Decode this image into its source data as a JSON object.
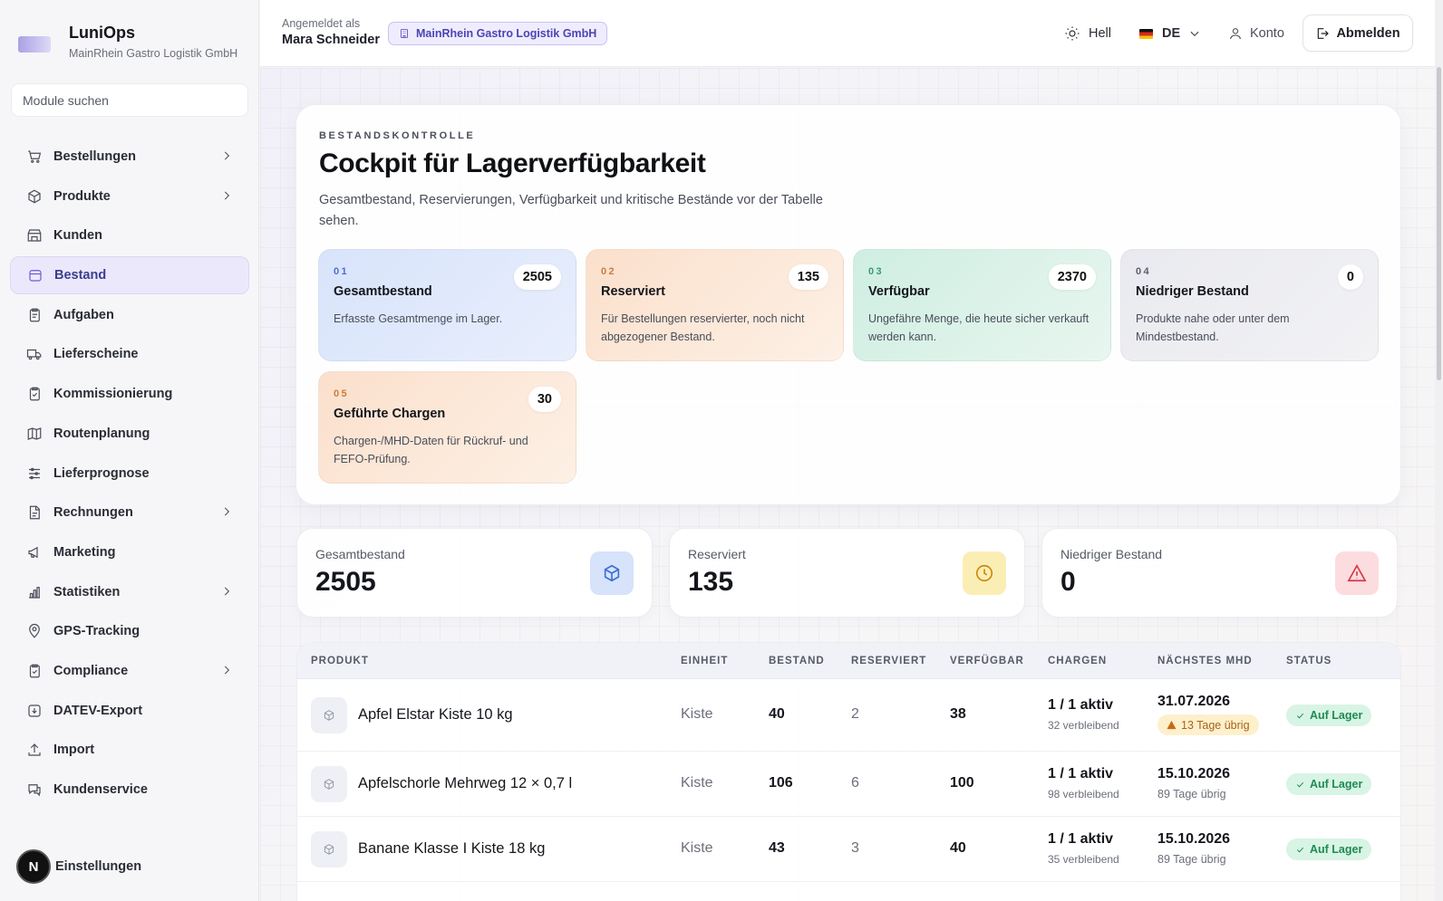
{
  "brand": {
    "name": "LuniOps",
    "company": "MainRhein Gastro Logistik GmbH"
  },
  "search": {
    "placeholder": "Module suchen"
  },
  "sidebar": {
    "items": [
      {
        "label": "Bestellungen",
        "icon": "cart-icon",
        "chevron": true
      },
      {
        "label": "Produkte",
        "icon": "box-icon",
        "chevron": true
      },
      {
        "label": "Kunden",
        "icon": "store-icon",
        "chevron": false
      },
      {
        "label": "Bestand",
        "icon": "inventory-icon",
        "chevron": false,
        "active": true
      },
      {
        "label": "Aufgaben",
        "icon": "clipboard-icon",
        "chevron": false
      },
      {
        "label": "Lieferscheine",
        "icon": "truck-icon",
        "chevron": false
      },
      {
        "label": "Kommissionierung",
        "icon": "clipboard-check-icon",
        "chevron": false
      },
      {
        "label": "Routenplanung",
        "icon": "map-icon",
        "chevron": false
      },
      {
        "label": "Lieferprognose",
        "icon": "sliders-icon",
        "chevron": false
      },
      {
        "label": "Rechnungen",
        "icon": "document-icon",
        "chevron": true
      },
      {
        "label": "Marketing",
        "icon": "megaphone-icon",
        "chevron": false
      },
      {
        "label": "Statistiken",
        "icon": "bar-chart-icon",
        "chevron": true
      },
      {
        "label": "GPS-Tracking",
        "icon": "map-pin-icon",
        "chevron": false
      },
      {
        "label": "Compliance",
        "icon": "clipboard-icon",
        "chevron": true
      },
      {
        "label": "DATEV-Export",
        "icon": "download-icon",
        "chevron": false
      },
      {
        "label": "Import",
        "icon": "upload-icon",
        "chevron": false
      },
      {
        "label": "Kundenservice",
        "icon": "chat-icon",
        "chevron": false
      }
    ],
    "settings_label": "Einstellungen",
    "avatar_letter": "N"
  },
  "header": {
    "caption": "Angemeldet als",
    "user": "Mara Schneider",
    "org_badge": "MainRhein Gastro Logistik GmbH",
    "theme": "Hell",
    "language": "DE",
    "account": "Konto",
    "logout": "Abmelden"
  },
  "hero": {
    "eyebrow": "BESTANDSKONTROLLE",
    "title": "Cockpit für Lagerverfügbarkeit",
    "description": "Gesamtbestand, Reservierungen, Verfügbarkeit und kritische Bestände vor der Tabelle sehen.",
    "cards": [
      {
        "num": "01",
        "title": "Gesamtbestand",
        "value": "2505",
        "desc": "Erfasste Gesamtmenge im Lager."
      },
      {
        "num": "02",
        "title": "Reserviert",
        "value": "135",
        "desc": "Für Bestellungen reservierter, noch nicht abgezogener Bestand."
      },
      {
        "num": "03",
        "title": "Verfügbar",
        "value": "2370",
        "desc": "Ungefähre Menge, die heute sicher verkauft werden kann."
      },
      {
        "num": "04",
        "title": "Niedriger Bestand",
        "value": "0",
        "desc": "Produkte nahe oder unter dem Mindestbestand."
      },
      {
        "num": "05",
        "title": "Geführte Chargen",
        "value": "30",
        "desc": "Chargen-/MHD-Daten für Rückruf- und FEFO-Prüfung."
      }
    ]
  },
  "stats": [
    {
      "label": "Gesamtbestand",
      "value": "2505",
      "icon": "cube-icon"
    },
    {
      "label": "Reserviert",
      "value": "135",
      "icon": "clock-icon"
    },
    {
      "label": "Niedriger Bestand",
      "value": "0",
      "icon": "alert-triangle-icon"
    }
  ],
  "table": {
    "columns": [
      "PRODUKT",
      "EINHEIT",
      "BESTAND",
      "RESERVIERT",
      "VERFÜGBAR",
      "CHARGEN",
      "NÄCHSTES MHD",
      "STATUS"
    ],
    "rows": [
      {
        "product": "Apfel Elstar Kiste 10 kg",
        "unit": "Kiste",
        "stock": "40",
        "reserved": "2",
        "available": "38",
        "batches": "1 / 1 aktiv",
        "batches_sub": "32 verbleibend",
        "mhd": "31.07.2026",
        "mhd_sub": "13 Tage übrig",
        "mhd_warning": true,
        "status": "Auf Lager"
      },
      {
        "product": "Apfelschorle Mehrweg 12 × 0,7 l",
        "unit": "Kiste",
        "stock": "106",
        "reserved": "6",
        "available": "100",
        "batches": "1 / 1 aktiv",
        "batches_sub": "98 verbleibend",
        "mhd": "15.10.2026",
        "mhd_sub": "89 Tage übrig",
        "mhd_warning": false,
        "status": "Auf Lager"
      },
      {
        "product": "Banane Klasse I Kiste 18 kg",
        "unit": "Kiste",
        "stock": "43",
        "reserved": "3",
        "available": "40",
        "batches": "1 / 1 aktiv",
        "batches_sub": "35 verbleibend",
        "mhd": "15.10.2026",
        "mhd_sub": "89 Tage übrig",
        "mhd_warning": false,
        "status": "Auf Lager"
      }
    ]
  }
}
